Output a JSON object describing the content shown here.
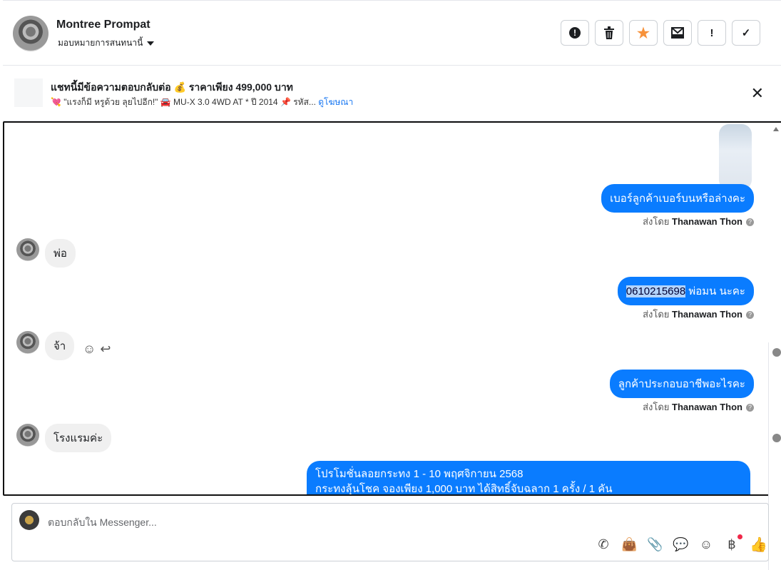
{
  "header": {
    "name": "Montree Prompat",
    "assign_label": "มอบหมายการสนทนานี้",
    "actions": [
      {
        "name": "alert-button",
        "glyph": "❗"
      },
      {
        "name": "trash-button",
        "glyph": "🗑"
      },
      {
        "name": "star-button",
        "glyph": "★"
      },
      {
        "name": "mark-unread-button",
        "glyph": "✉"
      },
      {
        "name": "spam-button",
        "glyph": "!"
      },
      {
        "name": "done-button",
        "glyph": "✓"
      }
    ]
  },
  "ad": {
    "title": "แชทนี้มีข้อความตอบกลับต่อ 💰 ราคาเพียง 499,000 บาท",
    "subtitle": "💘 \"แรงก็มี หรูด้วย ลุยไปอีก!\" 🚘 MU-X 3.0 4WD AT * ปี 2014 📌 รหัส...",
    "link": "ดูโฆษณา",
    "close": "✕"
  },
  "messages": {
    "m1": "เบอร์ลูกค้าเบอร์บนหรือล่างคะ",
    "sent_by_prefix": "ส่งโดย",
    "agent": "Thanawan Thon",
    "m2": "พ่อ",
    "m3_highlight": "0610215698",
    "m3_rest": " พ่อมน นะคะ",
    "m4": "จ้า",
    "m5": "ลูกค้าประกอบอาชีพอะไรคะ",
    "m6": "โรงแรมค่ะ",
    "m7_line1": "โปรโมชั่นลอยกระทง 1 - 10 พฤศจิกายน 2568",
    "m7_line2": "กระทงลุ้นโชค จองเพียง 1,000 บาท ได้สิทธิ์จับฉลาก 1 ครั้ง /  1 คัน"
  },
  "composer": {
    "placeholder": "ตอบกลับใน Messenger..."
  }
}
